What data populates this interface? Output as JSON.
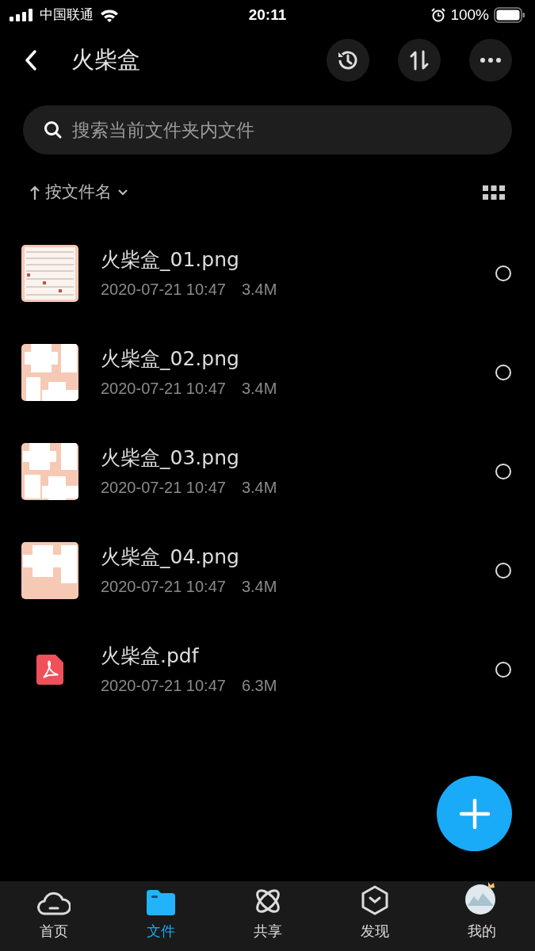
{
  "status_bar": {
    "carrier": "中国联通",
    "time": "20:11",
    "battery": "100%"
  },
  "header": {
    "title": "火柴盒"
  },
  "search": {
    "placeholder": "搜索当前文件夹内文件"
  },
  "sort": {
    "label": "按文件名"
  },
  "files": [
    {
      "kind": "picture",
      "name": "火柴盒_01.png",
      "date": "2020-07-21 10:47",
      "size": "3.4M",
      "selected": false
    },
    {
      "kind": "picture",
      "name": "火柴盒_02.png",
      "date": "2020-07-21 10:47",
      "size": "3.4M",
      "selected": false
    },
    {
      "kind": "picture",
      "name": "火柴盒_03.png",
      "date": "2020-07-21 10:47",
      "size": "3.4M",
      "selected": false
    },
    {
      "kind": "picture",
      "name": "火柴盒_04.png",
      "date": "2020-07-21 10:47",
      "size": "3.4M",
      "selected": false
    },
    {
      "kind": "pdf",
      "name": "火柴盒.pdf",
      "date": "2020-07-21 10:47",
      "size": "6.3M",
      "selected": false
    }
  ],
  "tabs": [
    {
      "kind": "home",
      "label": "首页",
      "selected": false
    },
    {
      "kind": "files",
      "label": "文件",
      "selected": true
    },
    {
      "kind": "share",
      "label": "共享",
      "selected": false
    },
    {
      "kind": "discover",
      "label": "发现",
      "selected": false
    },
    {
      "kind": "me",
      "label": "我的",
      "selected": false
    }
  ]
}
